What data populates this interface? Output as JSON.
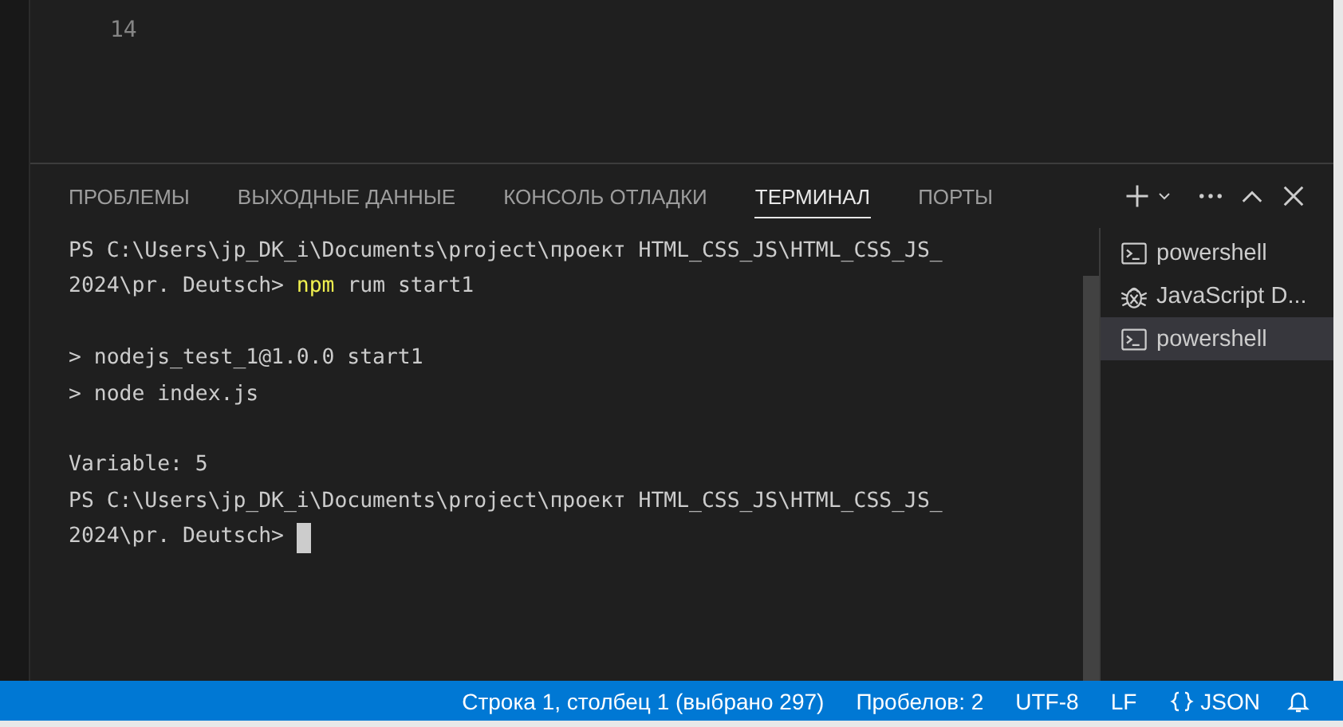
{
  "editor": {
    "line_numbers": [
      "14"
    ]
  },
  "panel": {
    "tabs": [
      {
        "label": "ПРОБЛЕМЫ",
        "selected": false
      },
      {
        "label": "ВЫХОДНЫЕ ДАННЫЕ",
        "selected": false
      },
      {
        "label": "КОНСОЛЬ ОТЛАДКИ",
        "selected": false
      },
      {
        "label": "ТЕРМИНАЛ",
        "selected": true
      },
      {
        "label": "ПОРТЫ",
        "selected": false
      }
    ],
    "actions": [
      {
        "kind": "add"
      },
      {
        "kind": "dropdown"
      },
      {
        "kind": "more"
      },
      {
        "kind": "maximize"
      },
      {
        "kind": "close"
      }
    ],
    "terminal_lines": [
      {
        "kind": "text",
        "segments": [
          {
            "text": "PS C:\\Users\\jp_DK_i\\Documents\\project\\проект HTML_CSS_JS\\HTML_CSS_JS_"
          }
        ]
      },
      {
        "kind": "text",
        "segments": [
          {
            "text": "2024\\pr. Deutsch> "
          },
          {
            "text": "npm",
            "kind": "command"
          },
          {
            "text": " rum start1"
          }
        ]
      },
      {
        "kind": "blank"
      },
      {
        "kind": "text",
        "segments": [
          {
            "text": "> nodejs_test_1@1.0.0 start1"
          }
        ]
      },
      {
        "kind": "text",
        "segments": [
          {
            "text": "> node index.js"
          }
        ]
      },
      {
        "kind": "blank"
      },
      {
        "kind": "text",
        "segments": [
          {
            "text": "Variable: 5"
          }
        ]
      },
      {
        "kind": "text",
        "segments": [
          {
            "text": "PS C:\\Users\\jp_DK_i\\Documents\\project\\проект HTML_CSS_JS\\HTML_CSS_JS_"
          }
        ]
      },
      {
        "kind": "text",
        "segments": [
          {
            "text": "2024\\pr. Deutsch> "
          },
          {
            "kind": "cursor"
          }
        ]
      }
    ],
    "terminals": [
      {
        "label": "powershell",
        "kind": "shell",
        "selected": false
      },
      {
        "label": "JavaScript D...",
        "kind": "debug",
        "selected": false
      },
      {
        "label": "powershell",
        "kind": "shell",
        "selected": true
      }
    ]
  },
  "status_bar": [
    {
      "text": "Строка 1, столбец 1 (выбрано 297)"
    },
    {
      "text": "Пробелов: 2"
    },
    {
      "text": "UTF-8"
    },
    {
      "text": "LF"
    },
    {
      "text": "JSON",
      "kind": "language"
    },
    {
      "kind": "bell"
    }
  ]
}
